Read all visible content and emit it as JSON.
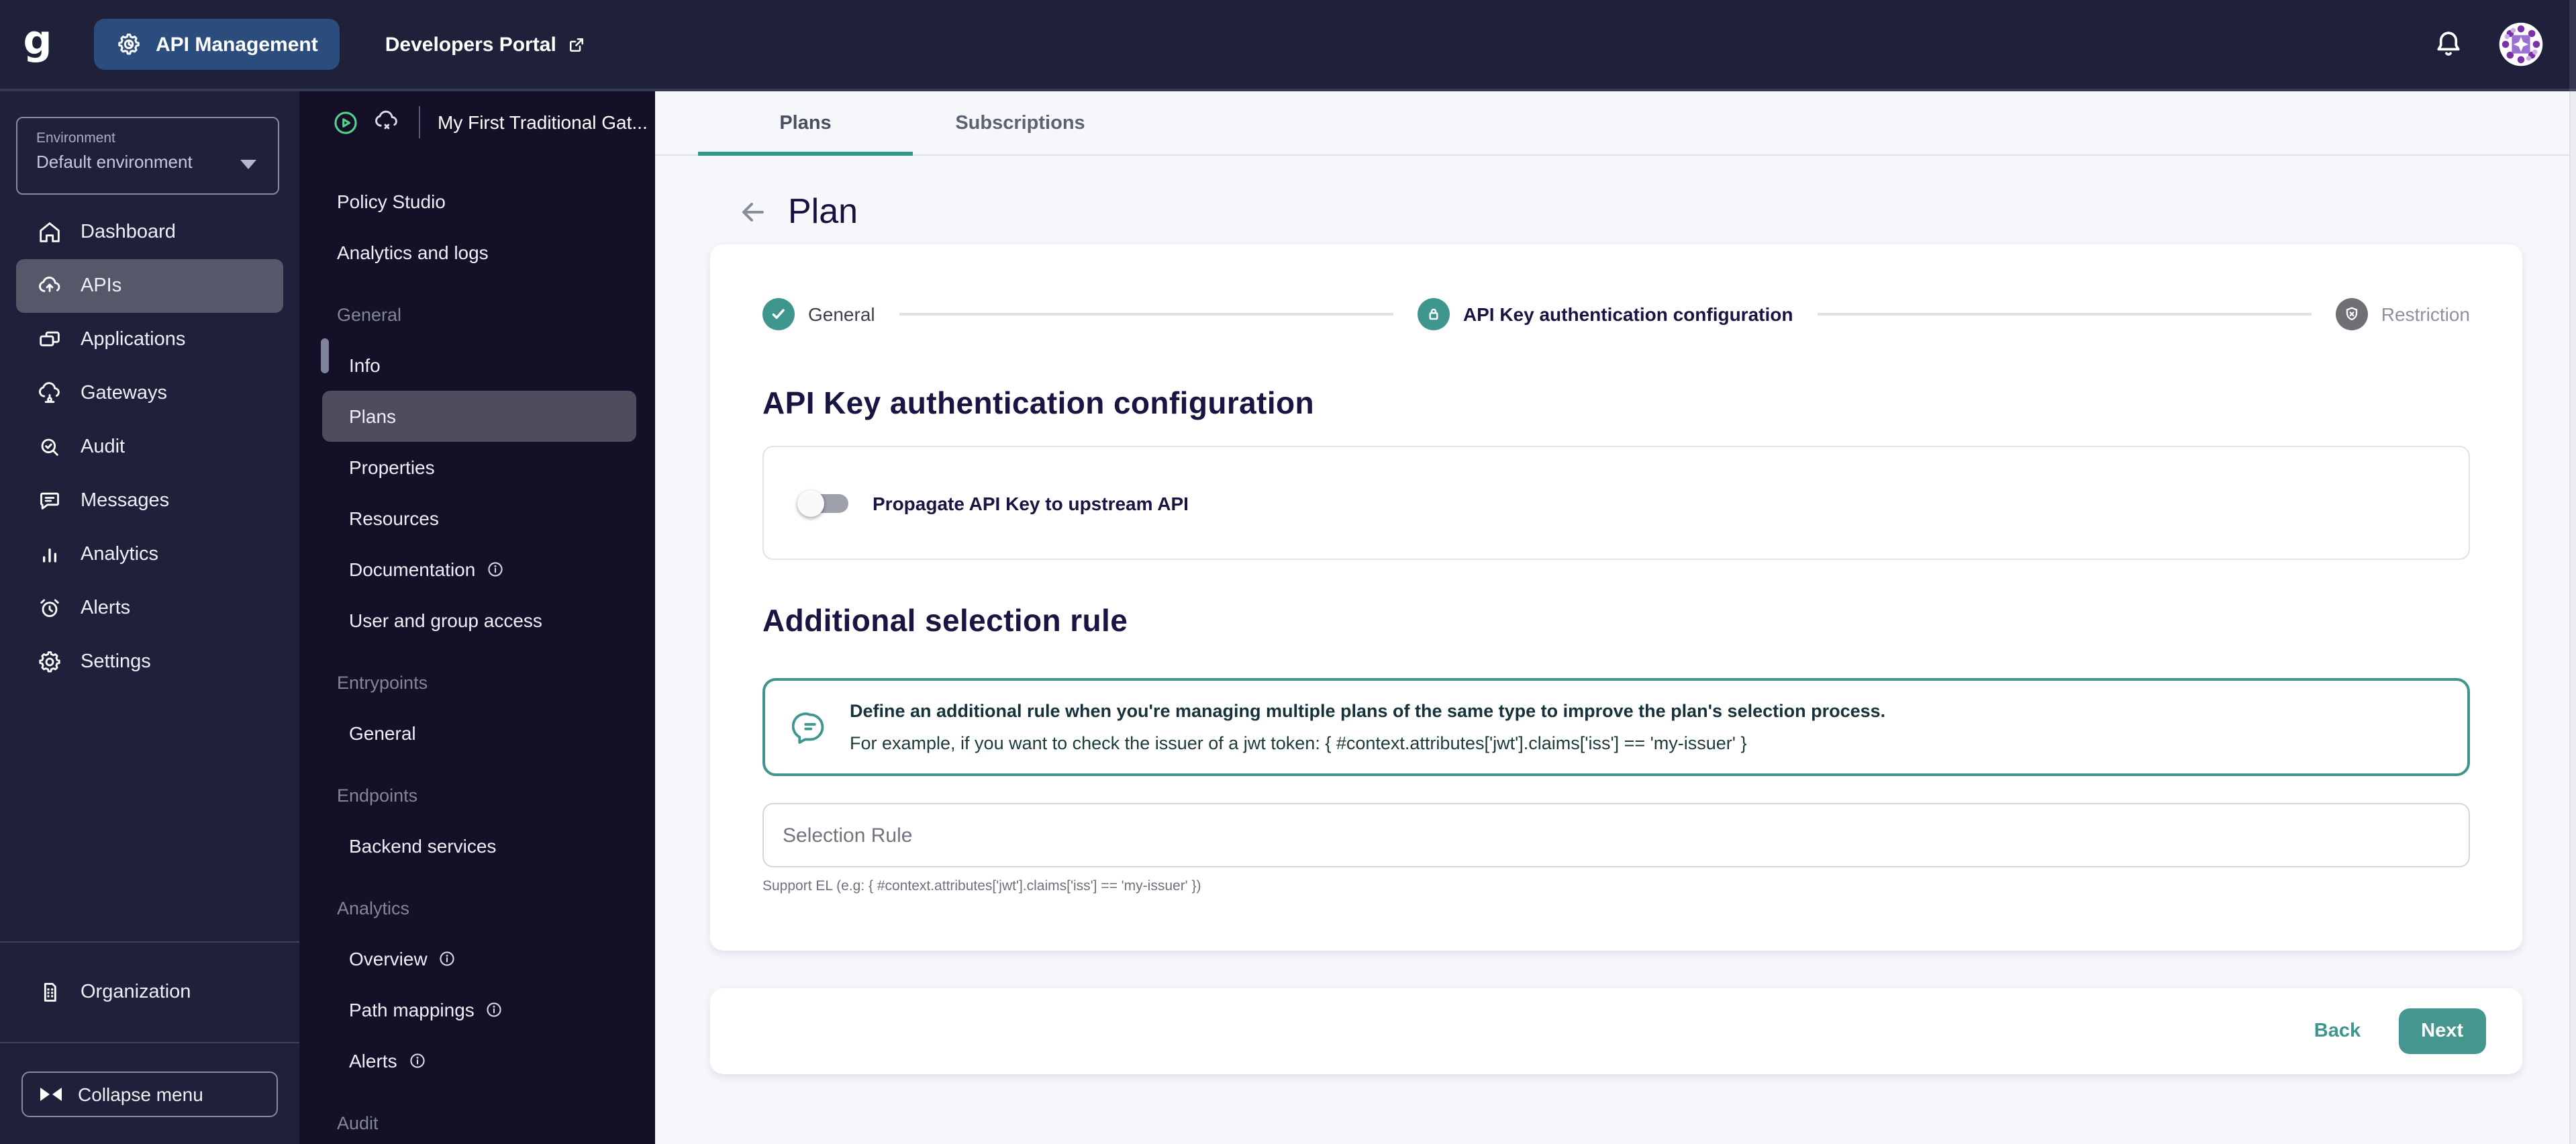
{
  "topbar": {
    "logo": "g",
    "app_button": "API Management",
    "portal_link": "Developers Portal"
  },
  "sidebar": {
    "environment": {
      "label": "Environment",
      "value": "Default environment"
    },
    "items": [
      {
        "label": "Dashboard",
        "icon": "home-icon",
        "selected": false
      },
      {
        "label": "APIs",
        "icon": "cloud-upload-icon",
        "selected": true
      },
      {
        "label": "Applications",
        "icon": "applications-icon",
        "selected": false
      },
      {
        "label": "Gateways",
        "icon": "gateway-cloud-icon",
        "selected": false
      },
      {
        "label": "Audit",
        "icon": "search-check-icon",
        "selected": false
      },
      {
        "label": "Messages",
        "icon": "message-bubble-icon",
        "selected": false
      },
      {
        "label": "Analytics",
        "icon": "bar-chart-icon",
        "selected": false
      },
      {
        "label": "Alerts",
        "icon": "alarm-clock-icon",
        "selected": false
      },
      {
        "label": "Settings",
        "icon": "gear-icon",
        "selected": false
      }
    ],
    "organization_label": "Organization",
    "collapse_label": "Collapse menu"
  },
  "api_menu": {
    "title": "My First Traditional Gat...",
    "status_icons": [
      "play-circle-icon",
      "cloud-not-deployed-icon"
    ],
    "items": [
      {
        "type": "link",
        "label": "Policy Studio"
      },
      {
        "type": "link",
        "label": "Analytics and logs"
      },
      {
        "type": "header",
        "label": "General"
      },
      {
        "type": "sublink",
        "label": "Info"
      },
      {
        "type": "sublink",
        "label": "Plans",
        "selected": true
      },
      {
        "type": "sublink",
        "label": "Properties"
      },
      {
        "type": "sublink",
        "label": "Resources"
      },
      {
        "type": "sublink",
        "label": "Documentation",
        "info": true
      },
      {
        "type": "sublink",
        "label": "User and group access"
      },
      {
        "type": "header",
        "label": "Entrypoints"
      },
      {
        "type": "sublink",
        "label": "General"
      },
      {
        "type": "header",
        "label": "Endpoints"
      },
      {
        "type": "sublink",
        "label": "Backend services"
      },
      {
        "type": "header",
        "label": "Analytics"
      },
      {
        "type": "sublink",
        "label": "Overview",
        "info": true
      },
      {
        "type": "sublink",
        "label": "Path mappings",
        "info": true
      },
      {
        "type": "sublink",
        "label": "Alerts",
        "info": true
      },
      {
        "type": "header",
        "label": "Audit"
      }
    ]
  },
  "plan": {
    "tabs": [
      "Plans",
      "Subscriptions"
    ],
    "page_title": "Plan",
    "stepper": [
      {
        "label": "General",
        "state": "done",
        "icon": "check-icon"
      },
      {
        "label": "API Key authentication configuration",
        "state": "active",
        "icon": "lock-icon"
      },
      {
        "label": "Restriction",
        "state": "todo",
        "icon": "shield-x-icon"
      }
    ],
    "auth_heading": "API Key authentication configuration",
    "toggle_label": "Propagate API Key to upstream API",
    "toggle_state": "off",
    "rule_heading": "Additional selection rule",
    "banner": {
      "line1": "Define an additional rule when you're managing multiple plans of the same type to improve the plan's selection process.",
      "line2": "For example, if you want to check the issuer of a jwt token: { #context.attributes['jwt'].claims['iss'] == 'my-issuer' }"
    },
    "selection_input": {
      "placeholder": "Selection Rule",
      "value": "",
      "hint": "Support EL (e.g: { #context.attributes['jwt'].claims['iss'] == 'my-issuer' })"
    },
    "footer": {
      "back_label": "Back",
      "next_label": "Next"
    }
  },
  "colors": {
    "accent_teal": "#3f968e",
    "tab_underline": "#2f9b8d",
    "topbar_bg": "#1e2139",
    "sidebar2_bg": "#131027",
    "app_button_bg": "#2b4d7d",
    "page_bg": "#f6f7fb",
    "heading_text": "#181543",
    "status_green": "#56d08a"
  }
}
